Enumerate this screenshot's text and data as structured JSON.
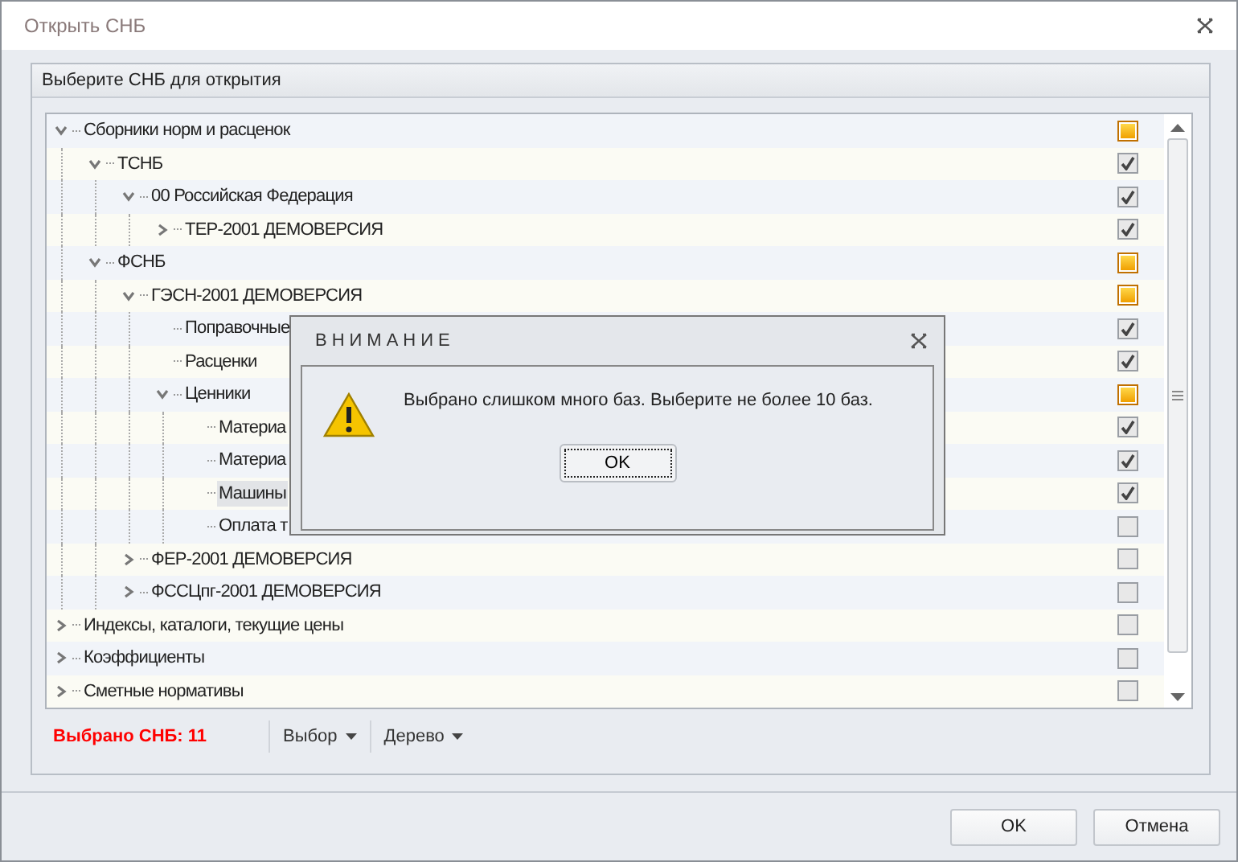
{
  "window": {
    "title": "Открыть СНБ"
  },
  "group": {
    "title": "Выберите СНБ для открытия"
  },
  "tree": [
    {
      "label": "Сборники норм и расценок",
      "expanded": true,
      "indeterminate": true,
      "selected": false,
      "children": [
        {
          "label": "ТСНБ",
          "expanded": true,
          "checked": true,
          "selected": false,
          "children": [
            {
              "label": "00 Российская Федерация",
              "expanded": true,
              "checked": true,
              "selected": false,
              "children": [
                {
                  "label": "ТЕР-2001 ДЕМОВЕРСИЯ",
                  "expanded": false,
                  "checked": true,
                  "selected": false
                }
              ]
            }
          ]
        },
        {
          "label": "ФСНБ",
          "expanded": true,
          "indeterminate": true,
          "selected": false,
          "children": [
            {
              "label": "ГЭСН-2001 ДЕМОВЕРСИЯ",
              "expanded": true,
              "indeterminate": true,
              "selected": false,
              "children": [
                {
                  "label": "Поправочные",
                  "checked": true,
                  "selected": false
                },
                {
                  "label": "Расценки",
                  "checked": true,
                  "selected": false
                },
                {
                  "label": "Ценники",
                  "expanded": true,
                  "indeterminate": true,
                  "selected": false,
                  "children": [
                    {
                      "label": "Материа",
                      "checked": true,
                      "selected": false
                    },
                    {
                      "label": "Материа",
                      "checked": true,
                      "selected": false
                    },
                    {
                      "label": "Машины",
                      "checked": true,
                      "selected": true
                    },
                    {
                      "label": "Оплата т",
                      "checked": false,
                      "selected": false
                    }
                  ]
                }
              ]
            },
            {
              "label": "ФЕР-2001 ДЕМОВЕРСИЯ",
              "expanded": false,
              "checked": false,
              "selected": false
            },
            {
              "label": "ФССЦпг-2001 ДЕМОВЕРСИЯ",
              "expanded": false,
              "checked": false,
              "selected": false
            }
          ]
        }
      ]
    },
    {
      "label": "Индексы, каталоги, текущие цены",
      "expanded": false,
      "checked": false,
      "selected": false
    },
    {
      "label": "Коэффициенты",
      "expanded": false,
      "checked": false,
      "selected": false
    },
    {
      "label": "Сметные нормативы",
      "expanded": false,
      "checked": false,
      "selected": false
    }
  ],
  "status": {
    "selected_count": "Выбрано СНБ: 11"
  },
  "menus": [
    "Выбор",
    "Дерево"
  ],
  "buttons": [
    "OK",
    "Отмена"
  ],
  "dialog": {
    "title": "ВНИМАНИЕ",
    "message": "Выбрано слишком много баз. Выберите не более 10 баз.",
    "button": "OK"
  }
}
